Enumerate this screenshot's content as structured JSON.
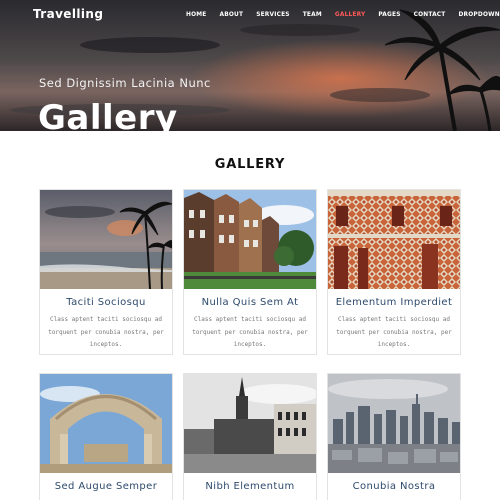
{
  "brand": "Travelling",
  "nav": [
    {
      "label": "HOME"
    },
    {
      "label": "ABOUT"
    },
    {
      "label": "SERVICES"
    },
    {
      "label": "TEAM"
    },
    {
      "label": "GALLERY"
    },
    {
      "label": "PAGES"
    },
    {
      "label": "CONTACT"
    },
    {
      "label": "DROPDOWN"
    }
  ],
  "hero": {
    "subtitle": "Sed Dignissim Lacinia Nunc",
    "title": "Gallery"
  },
  "section_title": "GALLERY",
  "cards": [
    {
      "caption": "Taciti Sociosqu",
      "desc": "Class aptent taciti sociosqu ad torquent per conubia nostra, per inceptos."
    },
    {
      "caption": "Nulla Quis Sem At",
      "desc": "Class aptent taciti sociosqu ad torquent per conubia nostra, per inceptos."
    },
    {
      "caption": "Elementum Imperdiet",
      "desc": "Class aptent taciti sociosqu ad torquent per conubia nostra, per inceptos."
    },
    {
      "caption": "Sed Augue Semper",
      "desc": ""
    },
    {
      "caption": "Nibh Elementum",
      "desc": ""
    },
    {
      "caption": "Conubia Nostra",
      "desc": ""
    }
  ],
  "colors": {
    "accent": "#ff5a5a",
    "caption": "#2d4a6b"
  },
  "icons": {
    "dropdown": "chevron-down-icon"
  }
}
